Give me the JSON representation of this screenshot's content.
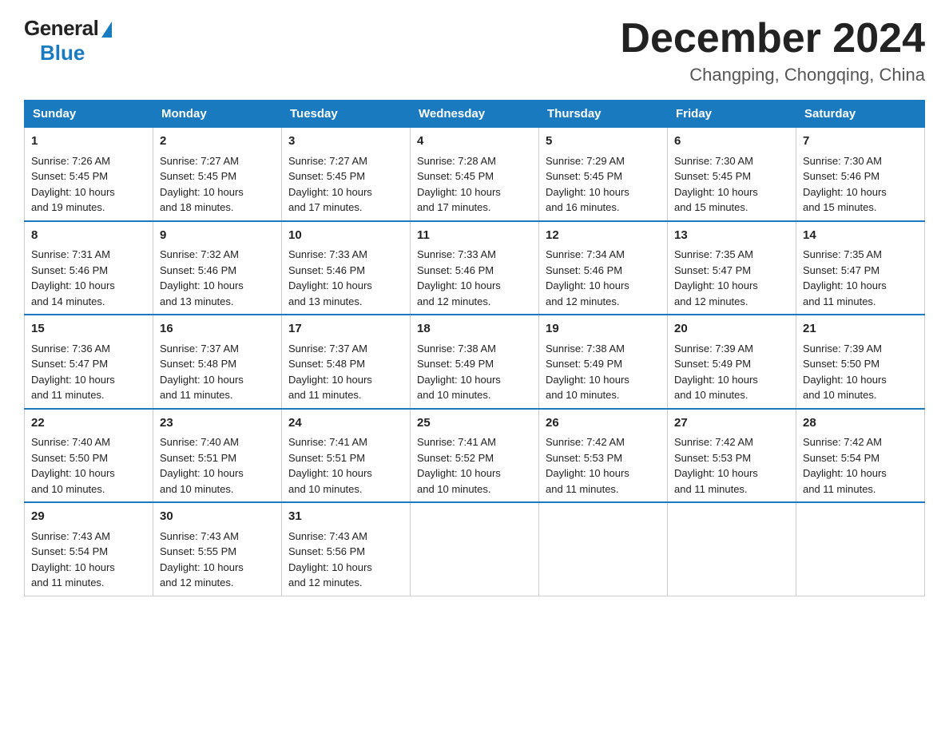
{
  "logo": {
    "general": "General",
    "blue": "Blue"
  },
  "title": "December 2024",
  "subtitle": "Changping, Chongqing, China",
  "days_of_week": [
    "Sunday",
    "Monday",
    "Tuesday",
    "Wednesday",
    "Thursday",
    "Friday",
    "Saturday"
  ],
  "weeks": [
    [
      {
        "day": "1",
        "info": "Sunrise: 7:26 AM\nSunset: 5:45 PM\nDaylight: 10 hours\nand 19 minutes."
      },
      {
        "day": "2",
        "info": "Sunrise: 7:27 AM\nSunset: 5:45 PM\nDaylight: 10 hours\nand 18 minutes."
      },
      {
        "day": "3",
        "info": "Sunrise: 7:27 AM\nSunset: 5:45 PM\nDaylight: 10 hours\nand 17 minutes."
      },
      {
        "day": "4",
        "info": "Sunrise: 7:28 AM\nSunset: 5:45 PM\nDaylight: 10 hours\nand 17 minutes."
      },
      {
        "day": "5",
        "info": "Sunrise: 7:29 AM\nSunset: 5:45 PM\nDaylight: 10 hours\nand 16 minutes."
      },
      {
        "day": "6",
        "info": "Sunrise: 7:30 AM\nSunset: 5:45 PM\nDaylight: 10 hours\nand 15 minutes."
      },
      {
        "day": "7",
        "info": "Sunrise: 7:30 AM\nSunset: 5:46 PM\nDaylight: 10 hours\nand 15 minutes."
      }
    ],
    [
      {
        "day": "8",
        "info": "Sunrise: 7:31 AM\nSunset: 5:46 PM\nDaylight: 10 hours\nand 14 minutes."
      },
      {
        "day": "9",
        "info": "Sunrise: 7:32 AM\nSunset: 5:46 PM\nDaylight: 10 hours\nand 13 minutes."
      },
      {
        "day": "10",
        "info": "Sunrise: 7:33 AM\nSunset: 5:46 PM\nDaylight: 10 hours\nand 13 minutes."
      },
      {
        "day": "11",
        "info": "Sunrise: 7:33 AM\nSunset: 5:46 PM\nDaylight: 10 hours\nand 12 minutes."
      },
      {
        "day": "12",
        "info": "Sunrise: 7:34 AM\nSunset: 5:46 PM\nDaylight: 10 hours\nand 12 minutes."
      },
      {
        "day": "13",
        "info": "Sunrise: 7:35 AM\nSunset: 5:47 PM\nDaylight: 10 hours\nand 12 minutes."
      },
      {
        "day": "14",
        "info": "Sunrise: 7:35 AM\nSunset: 5:47 PM\nDaylight: 10 hours\nand 11 minutes."
      }
    ],
    [
      {
        "day": "15",
        "info": "Sunrise: 7:36 AM\nSunset: 5:47 PM\nDaylight: 10 hours\nand 11 minutes."
      },
      {
        "day": "16",
        "info": "Sunrise: 7:37 AM\nSunset: 5:48 PM\nDaylight: 10 hours\nand 11 minutes."
      },
      {
        "day": "17",
        "info": "Sunrise: 7:37 AM\nSunset: 5:48 PM\nDaylight: 10 hours\nand 11 minutes."
      },
      {
        "day": "18",
        "info": "Sunrise: 7:38 AM\nSunset: 5:49 PM\nDaylight: 10 hours\nand 10 minutes."
      },
      {
        "day": "19",
        "info": "Sunrise: 7:38 AM\nSunset: 5:49 PM\nDaylight: 10 hours\nand 10 minutes."
      },
      {
        "day": "20",
        "info": "Sunrise: 7:39 AM\nSunset: 5:49 PM\nDaylight: 10 hours\nand 10 minutes."
      },
      {
        "day": "21",
        "info": "Sunrise: 7:39 AM\nSunset: 5:50 PM\nDaylight: 10 hours\nand 10 minutes."
      }
    ],
    [
      {
        "day": "22",
        "info": "Sunrise: 7:40 AM\nSunset: 5:50 PM\nDaylight: 10 hours\nand 10 minutes."
      },
      {
        "day": "23",
        "info": "Sunrise: 7:40 AM\nSunset: 5:51 PM\nDaylight: 10 hours\nand 10 minutes."
      },
      {
        "day": "24",
        "info": "Sunrise: 7:41 AM\nSunset: 5:51 PM\nDaylight: 10 hours\nand 10 minutes."
      },
      {
        "day": "25",
        "info": "Sunrise: 7:41 AM\nSunset: 5:52 PM\nDaylight: 10 hours\nand 10 minutes."
      },
      {
        "day": "26",
        "info": "Sunrise: 7:42 AM\nSunset: 5:53 PM\nDaylight: 10 hours\nand 11 minutes."
      },
      {
        "day": "27",
        "info": "Sunrise: 7:42 AM\nSunset: 5:53 PM\nDaylight: 10 hours\nand 11 minutes."
      },
      {
        "day": "28",
        "info": "Sunrise: 7:42 AM\nSunset: 5:54 PM\nDaylight: 10 hours\nand 11 minutes."
      }
    ],
    [
      {
        "day": "29",
        "info": "Sunrise: 7:43 AM\nSunset: 5:54 PM\nDaylight: 10 hours\nand 11 minutes."
      },
      {
        "day": "30",
        "info": "Sunrise: 7:43 AM\nSunset: 5:55 PM\nDaylight: 10 hours\nand 12 minutes."
      },
      {
        "day": "31",
        "info": "Sunrise: 7:43 AM\nSunset: 5:56 PM\nDaylight: 10 hours\nand 12 minutes."
      },
      {
        "day": "",
        "info": ""
      },
      {
        "day": "",
        "info": ""
      },
      {
        "day": "",
        "info": ""
      },
      {
        "day": "",
        "info": ""
      }
    ]
  ]
}
